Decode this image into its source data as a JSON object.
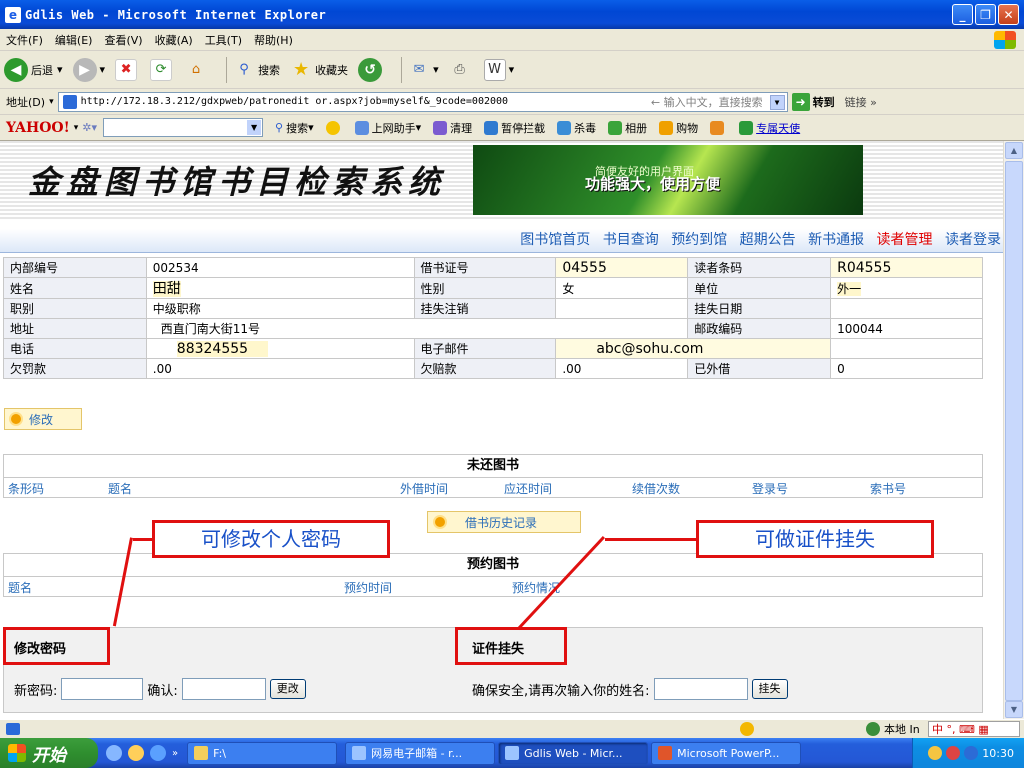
{
  "window": {
    "title": "Gdlis Web - Microsoft Internet Explorer"
  },
  "menu": [
    "文件(F)",
    "编辑(E)",
    "查看(V)",
    "收藏(A)",
    "工具(T)",
    "帮助(H)"
  ],
  "toolbar": {
    "back": "后退",
    "search": "搜索",
    "favorites": "收藏夹"
  },
  "address": {
    "label": "地址(D)",
    "url": "http://172.18.3.212/gdxpweb/patronedit or.aspx?job=myself&_9code=002000",
    "hint": "← 输入中文，直接搜索",
    "go": "转到",
    "links": "链接 »"
  },
  "yahoo": {
    "logo": "YAHOO!",
    "search": "搜索",
    "items": [
      "上网助手",
      "清理",
      "暂停拦截",
      "杀毒",
      "相册",
      "购物"
    ],
    "link": "专属天使"
  },
  "site": {
    "title": "金盘图书馆书目检索系统",
    "banner_line1": "简便友好的用户界面",
    "banner_line2": "功能强大，使用方便"
  },
  "nav": [
    "图书馆首页",
    "书目查询",
    "预约到馆",
    "超期公告",
    "新书通报",
    "读者管理",
    "读者登录"
  ],
  "patron": {
    "rows": [
      [
        "内部编号",
        "002534",
        "借书证号",
        "04555",
        "读者条码",
        "R04555"
      ],
      [
        "姓名",
        "田甜",
        "性别",
        "女",
        "单位",
        "外一"
      ],
      [
        "职别",
        "中级职称",
        "挂失注销",
        "",
        "挂失日期",
        ""
      ],
      [
        "地址",
        "西直门南大街11号",
        "",
        "",
        "邮政编码",
        "100044"
      ],
      [
        "电话",
        "88324555",
        "电子邮件",
        "abc@sohu.com",
        "",
        ""
      ],
      [
        "欠罚款",
        ".00",
        "欠赔款",
        ".00",
        "已外借",
        "0"
      ]
    ]
  },
  "buttons": {
    "modify": "修改",
    "history": "借书历史记录"
  },
  "unreturned": {
    "title": "未还图书",
    "columns": [
      "条形码",
      "题名",
      "外借时间",
      "应还时间",
      "续借次数",
      "登录号",
      "索书号"
    ]
  },
  "reserved": {
    "title": "预约图书",
    "columns": [
      "题名",
      "预约时间",
      "预约情况"
    ]
  },
  "callouts": {
    "password": "可修改个人密码",
    "loss": "可做证件挂失"
  },
  "password_panel": {
    "title": "修改密码",
    "new_label": "新密码:",
    "confirm_label": "确认:",
    "button": "更改"
  },
  "loss_panel": {
    "title": "证件挂失",
    "prompt": "确保安全,请再次输入你的姓名:",
    "button": "挂失"
  },
  "status": {
    "zone": "本地 In",
    "ime": "中 °, ⌨ ▦"
  },
  "taskbar": {
    "start": "开始",
    "tasks": [
      "F:\\",
      "网易电子邮箱 - r...",
      "Gdlis Web - Micr...",
      "Microsoft PowerP..."
    ],
    "clock": "10:30"
  },
  "colors": {
    "accent_red": "#e01010",
    "nav_blue": "#1e5db4",
    "active_nav": "#e00000"
  }
}
